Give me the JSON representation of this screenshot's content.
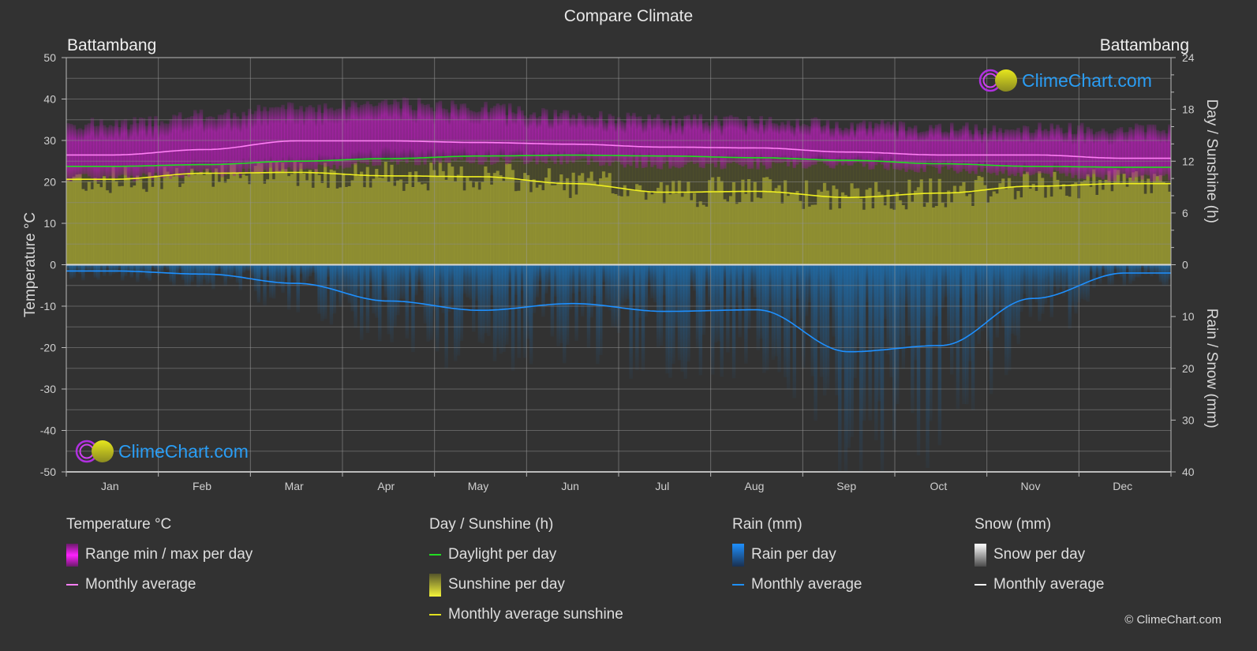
{
  "title": "Compare Climate",
  "location_left": "Battambang",
  "location_right": "Battambang",
  "logo_text": "ClimeChart.com",
  "copyright": "© ClimeChart.com",
  "colors": {
    "background": "#323232",
    "temp_range": "#c21fc2",
    "temp_avg": "#ff7ff5",
    "daylight": "#22dd22",
    "sunshine_fill": "#9a9a32",
    "sunshine_avg": "#f0f020",
    "rain_fill": "#1f6fae",
    "rain_avg": "#1e90ff",
    "snow_avg": "#ffffff",
    "logo_text": "#2a9df4"
  },
  "legend": {
    "temperature": {
      "heading": "Temperature °C",
      "items": [
        {
          "label": "Range min / max per day",
          "swatch": "bar",
          "color": "#e020e0"
        },
        {
          "label": "Monthly average",
          "swatch": "line",
          "color": "#ff7ff5"
        }
      ]
    },
    "sunshine": {
      "heading": "Day / Sunshine (h)",
      "items": [
        {
          "label": "Daylight per day",
          "swatch": "line",
          "color": "#22dd22"
        },
        {
          "label": "Sunshine per day",
          "swatch": "bar",
          "color": "#e8e83a"
        },
        {
          "label": "Monthly average sunshine",
          "swatch": "line",
          "color": "#e0e020"
        }
      ]
    },
    "rain": {
      "heading": "Rain (mm)",
      "items": [
        {
          "label": "Rain per day",
          "swatch": "bar",
          "color": "#1e90ff"
        },
        {
          "label": "Monthly average",
          "swatch": "line",
          "color": "#1e90ff"
        }
      ]
    },
    "snow": {
      "heading": "Snow (mm)",
      "items": [
        {
          "label": "Snow per day",
          "swatch": "bar",
          "color": "#e0e0e0"
        },
        {
          "label": "Monthly average",
          "swatch": "line",
          "color": "#ffffff"
        }
      ]
    }
  },
  "chart_data": {
    "type": "line",
    "title": "Compare Climate",
    "categories": [
      "Jan",
      "Feb",
      "Mar",
      "Apr",
      "May",
      "Jun",
      "Jul",
      "Aug",
      "Sep",
      "Oct",
      "Nov",
      "Dec"
    ],
    "axes": {
      "left": {
        "label": "Temperature °C",
        "range": [
          -50,
          50
        ],
        "ticks": [
          50,
          40,
          30,
          20,
          10,
          0,
          -10,
          -20,
          -30,
          -40,
          -50
        ]
      },
      "right_top": {
        "label": "Day / Sunshine (h)",
        "range": [
          0,
          24
        ],
        "ticks": [
          24,
          18,
          12,
          6,
          0
        ]
      },
      "right_bottom": {
        "label": "Rain / Snow (mm)",
        "range": [
          0,
          40
        ],
        "ticks": [
          0,
          10,
          20,
          30,
          40
        ],
        "inverted": true
      }
    },
    "grid": true,
    "series": [
      {
        "name": "Temperature monthly average (°C)",
        "axis": "left",
        "color": "#ff7ff5",
        "values": [
          26.5,
          27.8,
          29.9,
          29.9,
          29.5,
          29.1,
          28.4,
          28.2,
          27.2,
          26.5,
          26.5,
          25.7
        ]
      },
      {
        "name": "Temperature daily max (°C, approx upper envelope)",
        "axis": "left",
        "color": "#c21fc2",
        "values": [
          34,
          36,
          38,
          39,
          38,
          36,
          35,
          35,
          34,
          33,
          33,
          33
        ]
      },
      {
        "name": "Temperature daily min (°C, approx lower envelope)",
        "axis": "left",
        "color": "#c21fc2",
        "values": [
          21,
          22,
          23,
          25,
          25,
          25,
          24,
          24,
          24,
          23,
          22,
          21
        ]
      },
      {
        "name": "Daylight per day (h)",
        "axis": "right_top",
        "color": "#22dd22",
        "values": [
          11.4,
          11.6,
          12.0,
          12.3,
          12.6,
          12.7,
          12.6,
          12.4,
          12.1,
          11.7,
          11.4,
          11.3
        ]
      },
      {
        "name": "Monthly average sunshine (h)",
        "axis": "right_top",
        "color": "#f0f020",
        "values": [
          9.9,
          10.6,
          10.7,
          10.3,
          10.2,
          9.4,
          8.4,
          8.5,
          7.8,
          8.3,
          9.1,
          9.4
        ]
      },
      {
        "name": "Rain monthly average (mm)",
        "axis": "right_bottom",
        "color": "#1e90ff",
        "values": [
          1.2,
          1.8,
          3.6,
          7.0,
          8.8,
          7.5,
          9.0,
          8.7,
          16.8,
          15.6,
          6.5,
          1.6
        ]
      },
      {
        "name": "Snow monthly average (mm)",
        "axis": "right_bottom",
        "color": "#ffffff",
        "values": [
          0,
          0,
          0,
          0,
          0,
          0,
          0,
          0,
          0,
          0,
          0,
          0
        ]
      }
    ]
  }
}
